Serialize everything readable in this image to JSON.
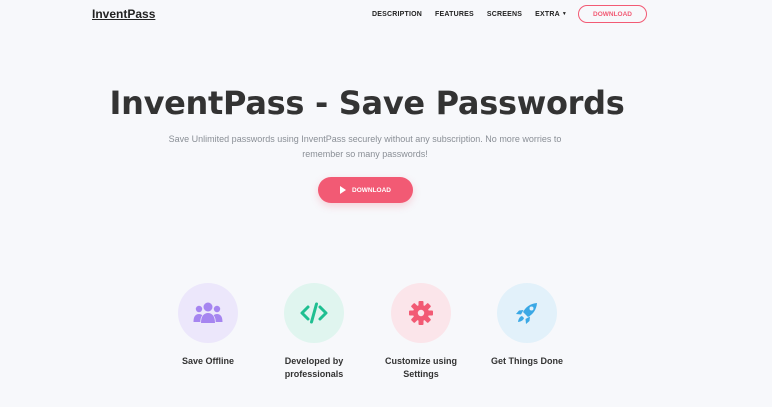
{
  "header": {
    "logo": "InventPass",
    "nav": [
      {
        "label": "DESCRIPTION"
      },
      {
        "label": "FEATURES"
      },
      {
        "label": "SCREENS"
      },
      {
        "label": "EXTRA"
      }
    ],
    "download_label": "DOWNLOAD"
  },
  "hero": {
    "title": "InventPass - Save Passwords",
    "subtitle_line1": "Save Unlimited passwords using InventPass securely without any subscription. No more worries to",
    "subtitle_line2": "remember so many passwords!",
    "button_label": "DOWNLOAD"
  },
  "features": [
    {
      "label_line1": "Save Offline",
      "label_line2": "",
      "icon": "users-icon",
      "color": "#a685f0",
      "bg": "#ece7fb"
    },
    {
      "label_line1": "Developed by",
      "label_line2": "professionals",
      "icon": "code-icon",
      "color": "#1fbf91",
      "bg": "#e0f5ef"
    },
    {
      "label_line1": "Customize using",
      "label_line2": "Settings",
      "icon": "gear-icon",
      "color": "#f25a74",
      "bg": "#fbe5ea"
    },
    {
      "label_line1": "Get Things Done",
      "label_line2": "",
      "icon": "rocket-icon",
      "color": "#3aa8e5",
      "bg": "#e2f1fa"
    }
  ],
  "colors": {
    "accent": "#f25a74",
    "background": "#f7f8fb",
    "text": "#333333",
    "muted": "#8a8f96"
  }
}
